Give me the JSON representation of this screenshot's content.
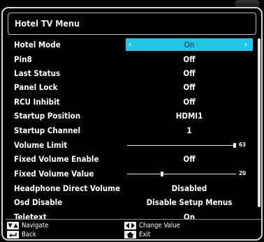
{
  "menu": {
    "title": "Hotel TV Menu"
  },
  "rows": [
    {
      "label": "Hotel Mode",
      "value": "On",
      "selected": true
    },
    {
      "label": "Pin8",
      "value": "Off"
    },
    {
      "label": "Last Status",
      "value": "Off"
    },
    {
      "label": "Panel Lock",
      "value": "Off"
    },
    {
      "label": "RCU Inhibit",
      "value": "Off"
    },
    {
      "label": "Startup Position",
      "value": "HDMI1"
    },
    {
      "label": "Startup Channel",
      "value": "1"
    },
    {
      "label": "Volume Limit",
      "slider_value": "63",
      "level": 0.99
    },
    {
      "label": "Fixed Volume Enable",
      "value": "Off"
    },
    {
      "label": "Fixed Volume Value",
      "slider_value": "20",
      "level": 0.32
    },
    {
      "label": "Headphone Direct Volume",
      "value": "Disabled"
    },
    {
      "label": "Osd Disable",
      "value": "Disable Setup Menus"
    },
    {
      "label": "Teletext",
      "value": "On"
    }
  ],
  "footer": {
    "navigate_label": "Navigate",
    "back_label": "Back",
    "change_value_label": "Change Value",
    "exit_label": "Exit"
  },
  "icons": {
    "selector_left": "‹",
    "selector_right": "›"
  },
  "colors": {
    "selection": "#24c6e8",
    "background": "#000000",
    "text": "#ffffff"
  }
}
